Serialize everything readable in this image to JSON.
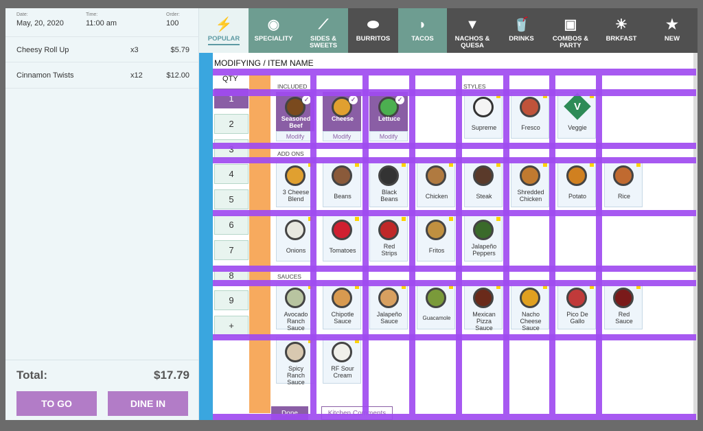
{
  "order": {
    "date_label": "Date:",
    "date": "May, 20, 2020",
    "time_label": "Time:",
    "time": "11:00 am",
    "order_label": "Order:",
    "order_no": "100",
    "items": [
      {
        "name": "Cheesy Roll Up",
        "qty": "x3",
        "price": "$5.79"
      },
      {
        "name": "Cinnamon Twists",
        "qty": "x12",
        "price": "$12.00"
      }
    ],
    "total_label": "Total:",
    "total": "$17.79",
    "to_go": "TO GO",
    "dine_in": "DINE IN"
  },
  "nav": {
    "popular": "POPULAR",
    "speciality": "SPECIALITY",
    "sides_1": "SIDES &",
    "sides_2": "SWEETS",
    "burritos": "BURRITOS",
    "tacos": "TACOS",
    "nachos_1": "NACHOS &",
    "nachos_2": "QUESA",
    "drinks": "DRINKS",
    "combos_1": "COMBOS &",
    "combos_2": "PARTY",
    "brkfast": "BRKFAST",
    "new": "NEW"
  },
  "main": {
    "title": "MODIFYING / ITEM NAME",
    "qty_title": "QTY",
    "qty_options": [
      "1",
      "2",
      "3",
      "4",
      "5",
      "6",
      "7",
      "8",
      "9",
      "+"
    ],
    "included_label": "INCLUDED",
    "styles_label": "STYLES",
    "addons_label": "ADD ONS",
    "sauces_label": "SAUCES",
    "included": [
      {
        "name1": "Seasoned",
        "name2": "Beef"
      },
      {
        "name1": "Cheese",
        "name2": ""
      },
      {
        "name1": "Lettuce",
        "name2": ""
      }
    ],
    "modify_label": "Modify",
    "styles": [
      "Supreme",
      "Fresco",
      "Veggie"
    ],
    "veggie_letter": "V",
    "addons_row1": [
      {
        "n1": "3 Cheese",
        "n2": "Blend"
      },
      {
        "n1": "Beans",
        "n2": ""
      },
      {
        "n1": "Black",
        "n2": "Beans"
      },
      {
        "n1": "Chicken",
        "n2": ""
      },
      {
        "n1": "Steak",
        "n2": ""
      },
      {
        "n1": "Shredded",
        "n2": "Chicken"
      },
      {
        "n1": "Potato",
        "n2": ""
      },
      {
        "n1": "Rice",
        "n2": ""
      }
    ],
    "addons_row2": [
      {
        "n1": "Onions",
        "n2": ""
      },
      {
        "n1": "Tomatoes",
        "n2": ""
      },
      {
        "n1": "Red",
        "n2": "Strips"
      },
      {
        "n1": "Fritos",
        "n2": ""
      },
      {
        "n1": "Jalapeño",
        "n2": "Peppers"
      }
    ],
    "sauces_row1": [
      {
        "n1": "Avocado",
        "n2": "Ranch",
        "n3": "Sauce"
      },
      {
        "n1": "Chipotle",
        "n2": "Sauce",
        "n3": ""
      },
      {
        "n1": "Jalapeño",
        "n2": "Sauce",
        "n3": ""
      },
      {
        "n1": "Guacamole",
        "n2": "",
        "n3": ""
      },
      {
        "n1": "Mexican",
        "n2": "Pizza",
        "n3": "Sauce"
      },
      {
        "n1": "Nacho",
        "n2": "Cheese",
        "n3": "Sauce"
      },
      {
        "n1": "Pico De",
        "n2": "Gallo",
        "n3": ""
      },
      {
        "n1": "Red",
        "n2": "Sauce",
        "n3": ""
      }
    ],
    "sauces_row2": [
      {
        "n1": "Spicy",
        "n2": "Ranch",
        "n3": "Sauce"
      },
      {
        "n1": "RF Sour",
        "n2": "Cream",
        "n3": ""
      }
    ],
    "done": "Done",
    "kitchen_comments": "Kitchen Comments"
  },
  "colors": {
    "accent_purple": "#8a5ea5",
    "button_purple": "#b27cc7",
    "teal": "#6e9d91",
    "blue_strip": "#3aa6df",
    "orange_strip": "#f7aa5e",
    "overlay_purple": "#a04bf0"
  }
}
